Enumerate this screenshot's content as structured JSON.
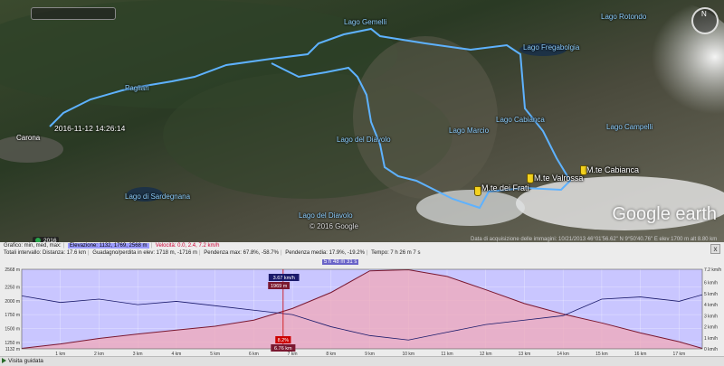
{
  "map": {
    "timestamp": "2016-11-12 14:26:14",
    "labels": {
      "pagliari": "Pagliari",
      "carona": "Carona",
      "lago_fregabolgia": "Lago Fregabolgia",
      "lago_rotondo": "Lago Rotondo",
      "lago_sardegnana": "Lago di Sardegnana",
      "lago_del_diavolo": "Lago del Diavolo",
      "lago_cabianca": "Lago Cabianca",
      "lago_campelli": "Lago Campelli",
      "lago_diavolo_nord": "Lago del Diavolo",
      "lago_gemelli": "Lago Gemelli",
      "lago_marcio": "Lago Marcio",
      "copyright": "© 2016 Google"
    },
    "peaks": {
      "valrossa": "M.te Valrossa",
      "cabianca": "M.te Cabianca",
      "frati": "M.te dei Frati"
    },
    "year_badge": "2016",
    "search_placeholder": "",
    "logo": "Google earth",
    "compass_n": "N",
    "status": "Data di acquisizione delle immagini: 10/21/2013   46°01'56.62\" N   9°50'40.76\" E   elev 1700 m   alt 8.80 km"
  },
  "panel": {
    "stats_line1": {
      "grafico": "Grafico: min, med, max:",
      "elevazione": "Elevazione: 1132, 1769, 2568 m",
      "velocita": "Velocità: 0.0, 2.4, 7.2 km/h"
    },
    "stats_line2": {
      "totali": "Totali intervallo: Distanza: 17.6 km",
      "guadagno": "Guadagno/perdita in elev: 1718 m, -1716 m",
      "pendenza": "Pendenza max: 67.8%, -58.7%",
      "pendenza_media": "Pendenza media: 17.9%, -19.2%",
      "tempo": "Tempo: 7 h 26 m 7 s"
    },
    "selection_badge": "5 h 48 m 31 s",
    "close_label": "x"
  },
  "footer": {
    "tour_label": "Visita guidata"
  },
  "chart_data": {
    "type": "line",
    "title": "",
    "x": [
      0,
      1,
      2,
      3,
      4,
      5,
      6,
      7,
      8,
      9,
      10,
      11,
      12,
      13,
      14,
      15,
      16,
      17,
      17.6
    ],
    "xlabel": "",
    "ylabel_left": "",
    "ylabel_right": "",
    "x_tick_labels": [
      "1 km",
      "2 km",
      "3 km",
      "4 km",
      "5 km",
      "6 km",
      "7 km",
      "8 km",
      "9 km",
      "10 km",
      "11 km",
      "12 km",
      "13 km",
      "14 km",
      "15 km",
      "16 km",
      "17 km"
    ],
    "x_ticks": [
      1,
      2,
      3,
      4,
      5,
      6,
      7,
      8,
      9,
      10,
      11,
      12,
      13,
      14,
      15,
      16,
      17
    ],
    "y_left_ticks": [
      1132,
      1250,
      1500,
      1750,
      2000,
      2250,
      2568
    ],
    "y_left_tick_labels": [
      "1132 m",
      "1250 m",
      "1500 m",
      "1750 m",
      "2000 m",
      "2250 m",
      "2568 m"
    ],
    "y_right_ticks": [
      0,
      1,
      2,
      3,
      4,
      5,
      6,
      7.2
    ],
    "y_right_tick_labels": [
      "0 km/h",
      "1 km/h",
      "2 km/h",
      "3 km/h",
      "4 km/h",
      "5 km/h",
      "6 km/h",
      "7.2 km/h"
    ],
    "ylim_left": [
      1132,
      2568
    ],
    "ylim_right": [
      0,
      7.2
    ],
    "series": [
      {
        "name": "Elevazione",
        "values": [
          1140,
          1220,
          1320,
          1400,
          1470,
          1540,
          1650,
          1860,
          2150,
          2540,
          2560,
          2440,
          2200,
          1950,
          1760,
          1600,
          1420,
          1260,
          1140
        ]
      },
      {
        "name": "Velocità",
        "values": [
          4.8,
          4.2,
          4.5,
          4.0,
          4.3,
          3.9,
          3.5,
          3.1,
          2.0,
          1.2,
          0.8,
          1.5,
          2.2,
          2.6,
          3.0,
          4.5,
          4.7,
          4.3,
          4.9
        ]
      }
    ],
    "markers": [
      {
        "label": "1969 m",
        "x": 6.65
      },
      {
        "label": "3.67 km/h",
        "x": 6.78
      },
      {
        "label": "6.76 km",
        "x": 6.76
      },
      {
        "label": "8.2%",
        "x": 6.76
      }
    ],
    "grid": true,
    "legend": "none"
  }
}
